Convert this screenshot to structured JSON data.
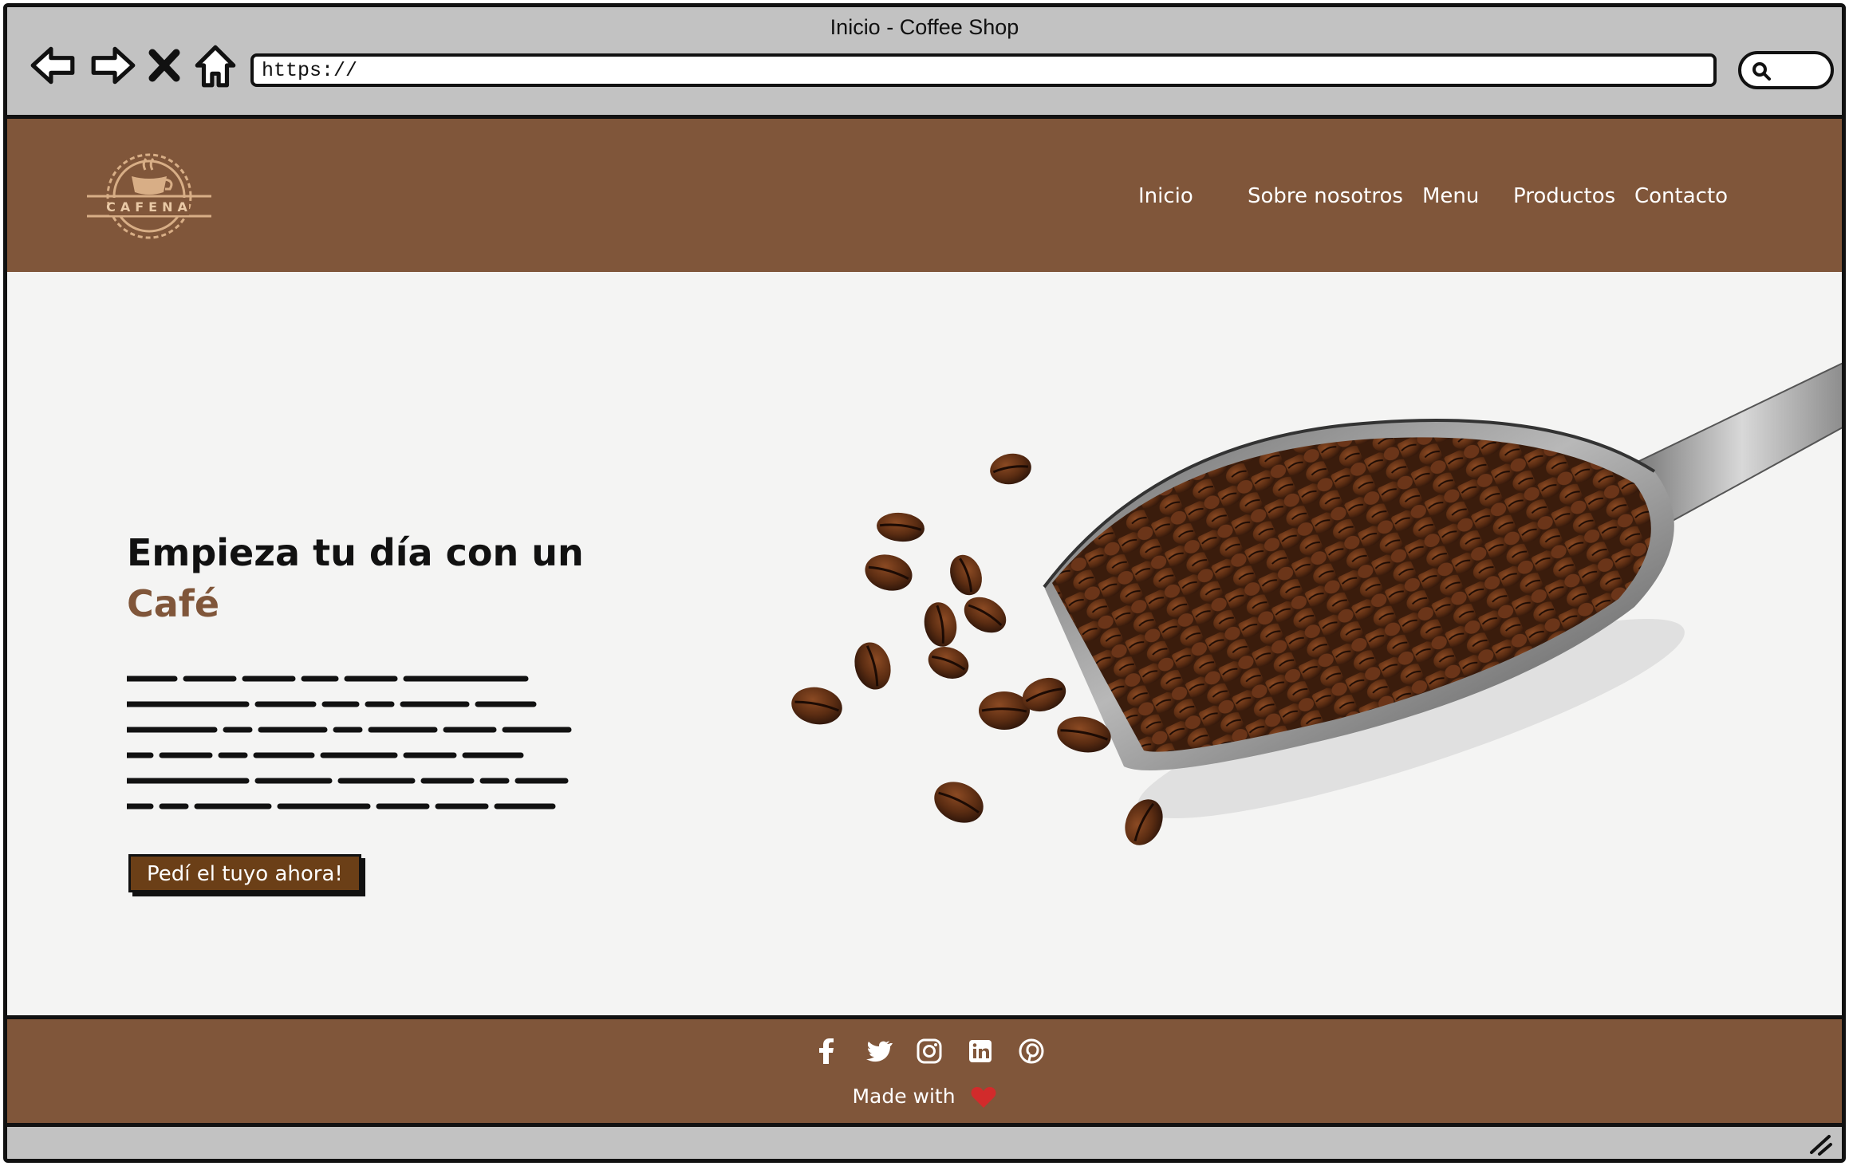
{
  "window": {
    "title": "Inicio - Coffee Shop",
    "address": "https://"
  },
  "toolbar": {
    "back_icon": "back-arrow-icon",
    "forward_icon": "forward-arrow-icon",
    "stop_icon": "close-icon",
    "home_icon": "home-icon",
    "search_icon": "search-icon"
  },
  "site": {
    "logo_text": "CAFENA",
    "nav": [
      "Inicio",
      "Sobre nosotros",
      "Menu",
      "Productos",
      "Contacto"
    ],
    "hero": {
      "title_line1": "Empieza tu día con un",
      "title_line2": "Café",
      "cta_label": "Pedí el tuyo ahora!"
    },
    "footer": {
      "socials": [
        "facebook-icon",
        "twitter-icon",
        "instagram-icon",
        "linkedin-icon",
        "pinterest-icon"
      ],
      "made_with": "Made with"
    }
  },
  "colors": {
    "brand_brown": "#80563a",
    "cta_brown": "#6b3f17",
    "chrome_gray": "#c2c2c2",
    "heart_red": "#d22b2b"
  }
}
